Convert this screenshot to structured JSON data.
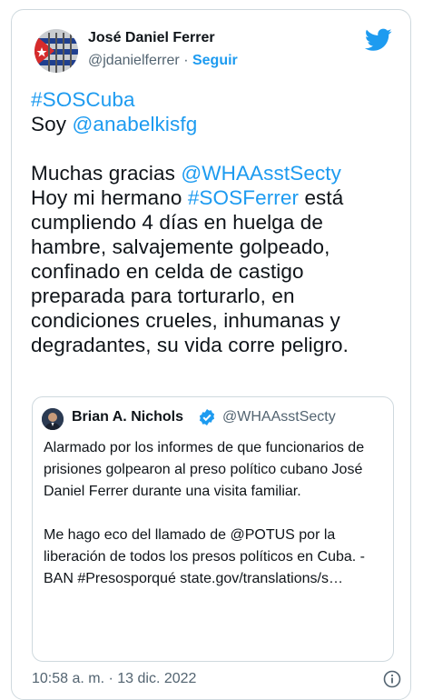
{
  "tweet": {
    "author_name": "José Daniel Ferrer",
    "author_handle": "@jdanielferrer",
    "separator": "·",
    "follow_label": "Seguir",
    "logo_icon": "twitter-bird-icon",
    "body": {
      "hashtag": "#SOSCuba",
      "line2_prefix": "Soy ",
      "mention": "@anabelkisfg",
      "para3_prefix": "Muchas gracias ",
      "mention2": "@WHAAsstSecty",
      "para3_mid": "Hoy mi hermano ",
      "hashtag2": "#SOSFerrer",
      "para3_rest": " está cumpliendo 4 días en huelga de hambre, salvajemente golpeado, confinado en celda de castigo preparada para torturarlo, en condiciones crueles, inhumanas y degradantes, su vida corre peligro."
    },
    "quoted": {
      "author_name": "Brian A. Nichols",
      "verified_icon": "verified-badge-icon",
      "author_handle": "@WHAAsstSecty",
      "paragraph1": "Alarmado por los informes de que funcionarios de prisiones golpearon al preso político cubano José Daniel Ferrer durante una visita familiar.",
      "paragraph2": "Me hago eco del llamado de @POTUS por la liberación de todos los presos políticos en Cuba. -BAN #Presosporqué state.gov/translations/s…"
    },
    "timestamp": "10:58 a. m. · 13 dic. 2022",
    "info_icon": "info-icon",
    "colors": {
      "link": "#1d9bf0",
      "text": "#0f1419",
      "muted": "#536471",
      "border": "#cfd9de"
    }
  }
}
